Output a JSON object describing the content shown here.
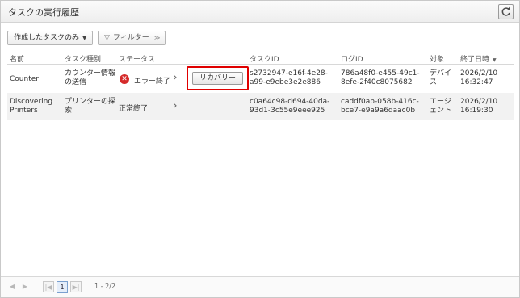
{
  "header": {
    "title": "タスクの実行履歴"
  },
  "toolbar": {
    "scope_label": "作成したタスクのみ",
    "filter_label": "フィルター"
  },
  "columns": [
    "名前",
    "タスク種別",
    "ステータス",
    "タスクID",
    "ログID",
    "対象",
    "終了日時"
  ],
  "rows": [
    {
      "name": "Counter",
      "type": [
        "カウンター情報",
        "の送信"
      ],
      "status": "エラー終了",
      "status_kind": "error",
      "task_id": [
        "s2732947-e16f-4e28-",
        "a99-e9ebe3e2e886"
      ],
      "log_id": [
        "786a48f0-e455-49c1-",
        "8efe-2f40c8075682"
      ],
      "target": [
        "デバイ",
        "ス"
      ],
      "ended": [
        "2026/2/10",
        "16:32:47"
      ]
    },
    {
      "name": [
        "Discovering",
        "Printers"
      ],
      "type": [
        "プリンターの探",
        "索"
      ],
      "status": "正常終了",
      "status_kind": "success",
      "task_id": [
        "c0a64c98-d694-40da-",
        "93d1-3c55e9eee925"
      ],
      "log_id": [
        "caddf0ab-058b-416c-",
        "bce7-e9a9a6daac0b"
      ],
      "target": [
        "エージ",
        "ェント"
      ],
      "ended": [
        "2026/2/10",
        "16:19:30"
      ]
    }
  ],
  "recover_button": "リカバリー",
  "pagination": {
    "current": "1",
    "range": "1 - 2/2"
  },
  "colors": {
    "error": "#d52a2a",
    "highlight": "#e00000",
    "selected_page": "#e5eefa"
  }
}
